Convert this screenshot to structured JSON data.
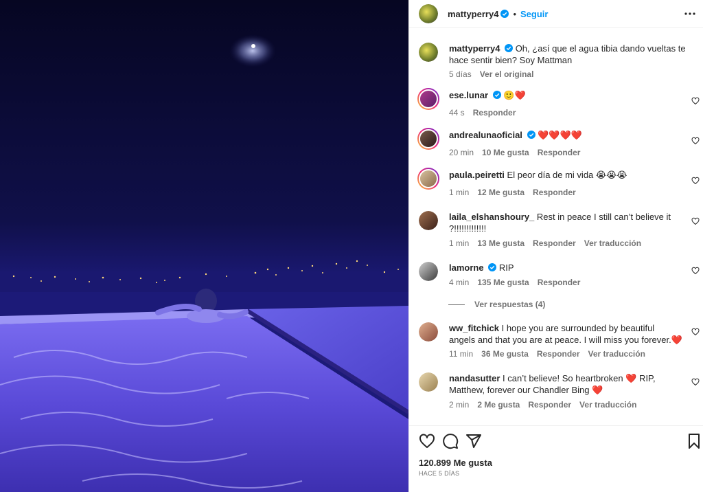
{
  "post": {
    "author": "mattyperry4",
    "follow_label": "Seguir",
    "separator": "•"
  },
  "caption": {
    "username": "mattyperry4",
    "text": "Oh, ¿así que el agua tibia dando vueltas te hace sentir bien? Soy Mattman",
    "time": "5 días",
    "see_original": "Ver el original"
  },
  "comments": [
    {
      "username": "ese.lunar",
      "verified": true,
      "text": "🙂❤️",
      "time": "44 s",
      "likes": "",
      "reply": "Responder",
      "translate": ""
    },
    {
      "username": "andrealunaoficial",
      "verified": true,
      "text": "❤️❤️❤️❤️",
      "time": "20 min",
      "likes": "10 Me gusta",
      "reply": "Responder",
      "translate": ""
    },
    {
      "username": "paula.peiretti",
      "verified": false,
      "text": "El peor día de mi vida 😭😭😭",
      "time": "1 min",
      "likes": "12 Me gusta",
      "reply": "Responder",
      "translate": ""
    },
    {
      "username": "laila_elshanshoury_",
      "verified": false,
      "text": "Rest in peace I still can’t believe it ?!!!!!!!!!!!!!",
      "time": "1 min",
      "likes": "13 Me gusta",
      "reply": "Responder",
      "translate": "Ver traducción"
    },
    {
      "username": "lamorne",
      "verified": true,
      "text": "RIP",
      "time": "4 min",
      "likes": "135 Me gusta",
      "reply": "Responder",
      "translate": ""
    },
    {
      "username": "ww_fitchick",
      "verified": false,
      "text": "I hope you are surrounded by beautiful angels and that you are at peace. I will miss you forever.❤️",
      "time": "11 min",
      "likes": "36 Me gusta",
      "reply": "Responder",
      "translate": "Ver traducción"
    },
    {
      "username": "nandasutter",
      "verified": false,
      "text": "I can’t believe! So heartbroken ❤️ RIP, Matthew, forever our Chandler Bing ❤️",
      "time": "2 min",
      "likes": "2 Me gusta",
      "reply": "Responder",
      "translate": "Ver traducción"
    }
  ],
  "view_replies": "Ver respuestas (4)",
  "footer": {
    "likes": "120.899 Me gusta",
    "ago": "HACE 5 DÍAS"
  },
  "colors": {
    "accent": "#0095f6",
    "verified": "#0095f6",
    "heart": "#ff3040",
    "muted": "#737373"
  },
  "icons": [
    "more-icon",
    "verified-icon",
    "heart-icon",
    "comment-icon",
    "share-icon",
    "bookmark-icon"
  ]
}
